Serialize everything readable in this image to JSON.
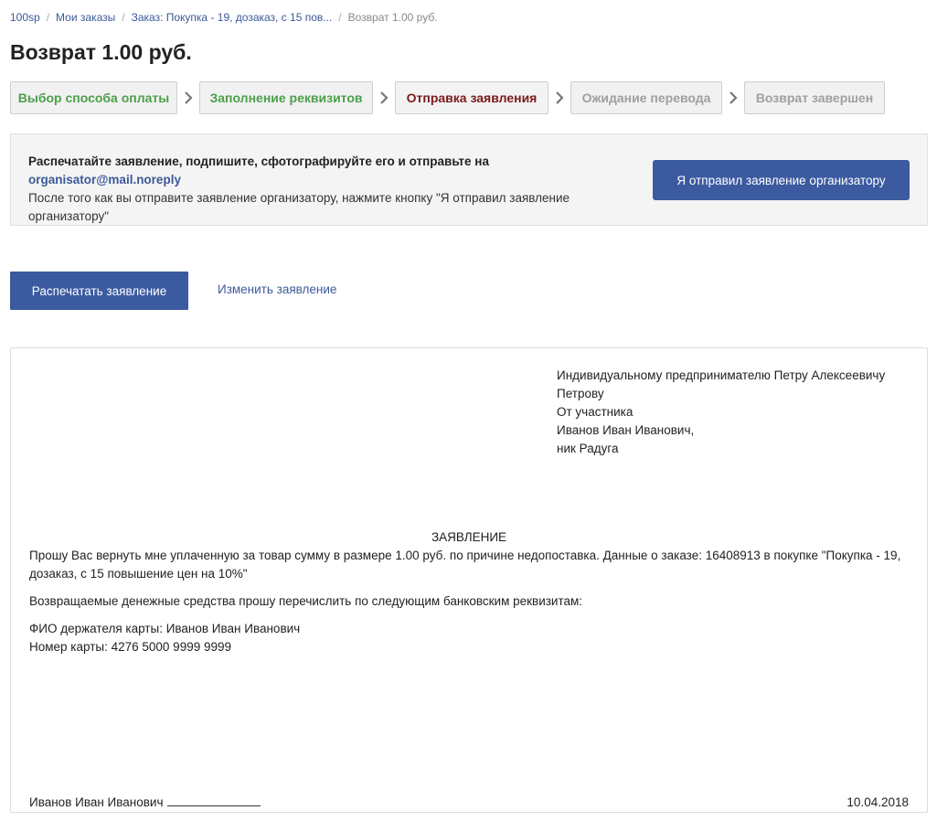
{
  "breadcrumb": {
    "items": [
      "100sp",
      "Мои заказы",
      "Заказ: Покупка - 19, дозаказ, с 15 пов..."
    ],
    "current": "Возврат 1.00 руб."
  },
  "page": {
    "title": "Возврат 1.00 руб."
  },
  "steps": [
    {
      "label": "Выбор способа оплаты",
      "state": "done"
    },
    {
      "label": "Заполнение реквизитов",
      "state": "done"
    },
    {
      "label": "Отправка заявления",
      "state": "active"
    },
    {
      "label": "Ожидание перевода",
      "state": "todo"
    },
    {
      "label": "Возврат завершен",
      "state": "todo"
    }
  ],
  "notice": {
    "strong_text": "Распечатайте заявление, подпишите, сфотографируйте его и отправьте на",
    "email": "organisator@mail.noreply",
    "text": "После того как вы отправите заявление организатору, нажмите кнопку \"Я отправил заявление организатору\"",
    "confirm_button": "Я отправил заявление организатору"
  },
  "actions": {
    "print_button": "Распечатать заявление",
    "edit_link": "Изменить заявление"
  },
  "document": {
    "addressee_lines": [
      "Индивидуальному предпринимателю Петру Алексеевичу Петрову",
      "От участника",
      "Иванов Иван Иванович,",
      "ник Радуга"
    ],
    "heading": "ЗАЯВЛЕНИЕ",
    "paragraphs": [
      "Прошу Вас вернуть мне уплаченную за товар сумму в размере 1.00 руб. по причине недопоставка. Данные о заказе: 16408913 в покупке \"Покупка - 19, дозаказ, с 15 повышение цен на 10%\"",
      "Возвращаемые денежные средства прошу перечислить по следующим банковским реквизитам:"
    ],
    "card_holder": "ФИО держателя карты: Иванов Иван Иванович",
    "card_number": "Номер карты: 4276 5000 9999 9999",
    "signature_name": "Иванов Иван Иванович",
    "date": "10.04.2018"
  },
  "colors": {
    "accent": "#3b5aa0",
    "link": "#3b5998",
    "step_done": "#4c9f4c",
    "step_active": "#7a1a1a",
    "step_todo": "#a0a0a0"
  }
}
